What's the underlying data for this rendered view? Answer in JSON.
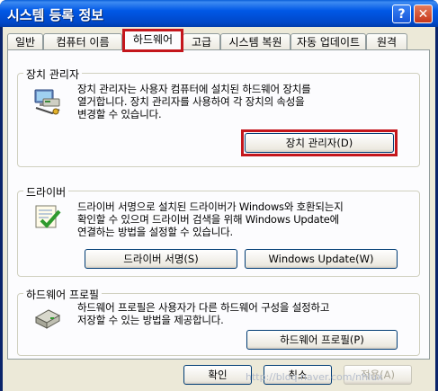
{
  "window": {
    "title": "시스템 등록 정보"
  },
  "titlebar": {
    "help_label": "?",
    "close_label": "✕"
  },
  "tabs": [
    {
      "label": "일반"
    },
    {
      "label": "컴퓨터 이름"
    },
    {
      "label": "하드웨어"
    },
    {
      "label": "고급"
    },
    {
      "label": "시스템 복원"
    },
    {
      "label": "자동 업데이트"
    },
    {
      "label": "원격"
    }
  ],
  "device_manager": {
    "title": "장치 관리자",
    "description": [
      "장치 관리자는 사용자 컴퓨터에 설치된 하드웨어 장치를",
      "열거합니다. 장치 관리자를 사용하여 각 장치의 속성을",
      "변경할 수 있습니다."
    ],
    "button": "장치 관리자(D)",
    "icon": "device-manager-icon"
  },
  "drivers": {
    "title": "드라이버",
    "description": [
      "드라이버 서명으로 설치된 드라이버가 Windows와 호환되는지",
      "확인할 수 있으며 드라이버 검색을 위해 Windows Update에",
      "연결하는 방법을 설정할 수 있습니다."
    ],
    "signing_button": "드라이버 서명(S)",
    "update_button": "Windows Update(W)",
    "icon": "driver-signing-icon"
  },
  "hardware_profiles": {
    "title": "하드웨어 프로필",
    "description": [
      "하드웨어 프로필은 사용자가 다른 하드웨어 구성을 설정하고",
      "저장할 수 있는 방법을 제공합니다."
    ],
    "button": "하드웨어 프로필(P)",
    "icon": "hardware-profile-icon"
  },
  "footer": {
    "ok": "확인",
    "cancel": "취소",
    "apply": "적용(A)"
  },
  "watermark": "http://bloq.naver.com/nhlux"
}
